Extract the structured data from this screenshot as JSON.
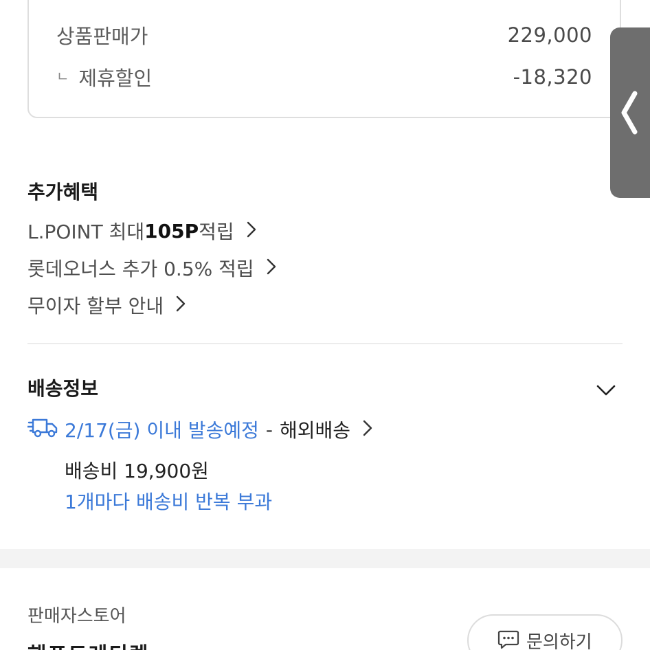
{
  "price_box": {
    "sale_price_label": "상품판매가",
    "sale_price_value": "229,000",
    "discount_mark": "ㄴ",
    "discount_label": "제휴할인",
    "discount_value": "-18,320"
  },
  "side_tab": {
    "icon": "chevron-left-icon"
  },
  "benefits": {
    "title": "추가혜택",
    "items": [
      {
        "pre": "L.POINT 최대 ",
        "strong": "105P",
        "post": " 적립"
      },
      {
        "pre": "롯데오너스 추가 0.5% 적립",
        "strong": "",
        "post": ""
      },
      {
        "pre": "무이자 할부 안내",
        "strong": "",
        "post": ""
      }
    ]
  },
  "delivery": {
    "title": "배송정보",
    "schedule": "2/17(금) 이내 발송예정",
    "dash": "-",
    "type": "해외배송",
    "fee": "배송비 19,900원",
    "repeat_note": "1개마다 배송비 반복 부과"
  },
  "store": {
    "label": "판매자스토어",
    "name": "해프트레디렉",
    "inquiry_label": "문의하기"
  },
  "colors": {
    "accent_blue": "#3b79d8",
    "side_tab": "#6e6e6e"
  }
}
